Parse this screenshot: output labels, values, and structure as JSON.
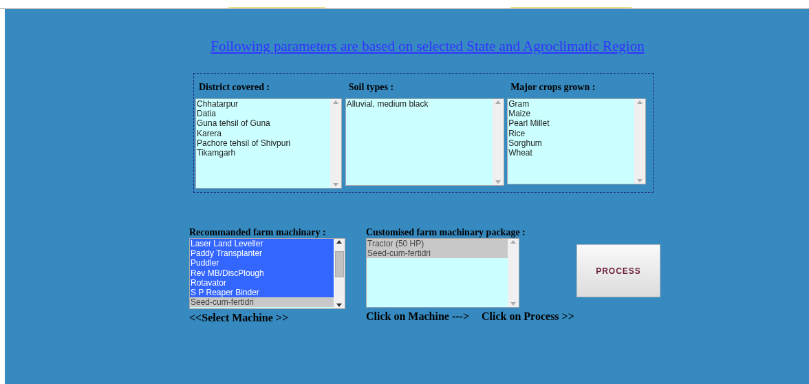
{
  "heading_link": "Following parameters are based on selected State and Agroclimatic Region",
  "parameters": [
    {
      "label": "District covered :",
      "items": [
        "Chhatarpur",
        "Datia",
        "Guna tehsil of Guna",
        "Karera",
        "Pachore tehsil of Shivpuri",
        "Tikamgarh"
      ]
    },
    {
      "label": "Soil types :",
      "items": [
        "Alluvial, medium black"
      ]
    },
    {
      "label": "Major crops grown :",
      "items": [
        "Gram",
        "Maize",
        "Pearl Millet",
        "Rice",
        "Sorghum",
        "Wheat"
      ]
    }
  ],
  "recommended": {
    "label": "Recommanded farm machinary :",
    "items": [
      {
        "text": "Laser Land Leveller",
        "selected": true,
        "dimmed": false
      },
      {
        "text": "Paddy Transplanter",
        "selected": true,
        "dimmed": false
      },
      {
        "text": "Puddler",
        "selected": true,
        "dimmed": false
      },
      {
        "text": "Rev MB/DiscPlough",
        "selected": true,
        "dimmed": false
      },
      {
        "text": "Rotavator",
        "selected": true,
        "dimmed": false
      },
      {
        "text": "S P Reaper Binder",
        "selected": true,
        "dimmed": false
      },
      {
        "text": "Seed-cum-fertidri",
        "selected": true,
        "dimmed": true
      }
    ],
    "hint": "<<Select Machine >>"
  },
  "customised": {
    "label": "Customised farm machinary package :",
    "items": [
      {
        "text": "Tractor (50 HP)",
        "selected": true,
        "dimmed": true
      },
      {
        "text": "Seed-cum-fertidri",
        "selected": true,
        "dimmed": true
      }
    ],
    "hint": "Click on Machine --->"
  },
  "process": {
    "button": "PROCESS",
    "hint": "Click on Process >>"
  }
}
